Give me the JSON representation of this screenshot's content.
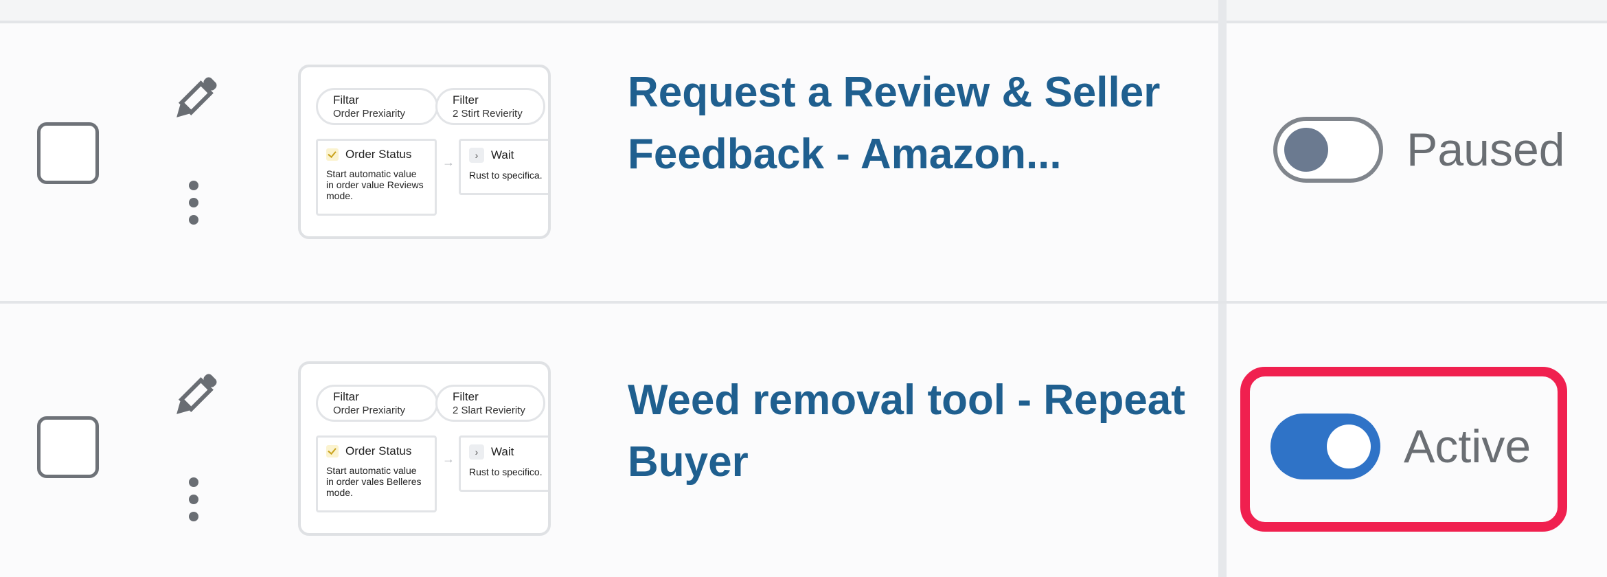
{
  "rows": [
    {
      "title": "Request a Review & Seller Feedback - Amazon...",
      "status": "Paused",
      "active": false,
      "thumbnail": {
        "filter1_label": "Filtar",
        "filter1_value": "Order Prexiarity",
        "filter2_label": "Filter",
        "filter2_value": "2 Stirt Revierity",
        "card1_title": "Order Status",
        "card1_body": "Start automatic value in order value Reviews mode.",
        "card2_title": "Wait",
        "card2_body": "Rust to specifica."
      }
    },
    {
      "title": "Weed removal tool - Repeat Buyer",
      "status": "Active",
      "active": true,
      "thumbnail": {
        "filter1_label": "Filtar",
        "filter1_value": "Order Prexiarity",
        "filter2_label": "Filter",
        "filter2_value": "2 Slart Revierity",
        "card1_title": "Order Status",
        "card1_body": "Start automatic value in order vales Belleres mode.",
        "card2_title": "Wait",
        "card2_body": "Rust to specifico."
      }
    }
  ],
  "icons": {
    "edit": "pencil-icon",
    "more": "more-vertical-icon",
    "select": "checkbox"
  },
  "colors": {
    "title": "#1f5f8f",
    "toggle_active": "#2f73c7",
    "toggle_paused_knob": "#6b7a90",
    "highlight": "#f0204f"
  }
}
